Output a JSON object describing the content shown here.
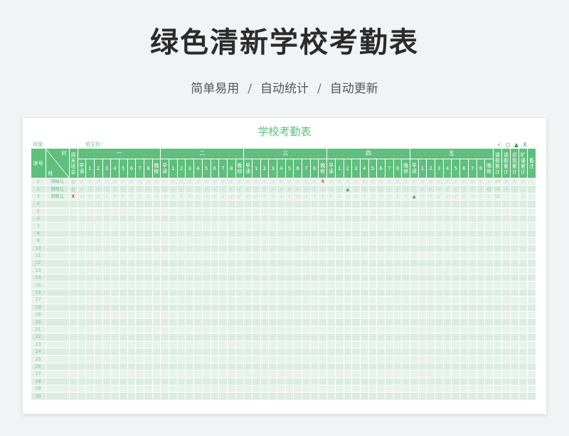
{
  "page": {
    "title": "绿色清新学校考勤表",
    "subtitle": [
      "简单易用",
      "自动统计",
      "自动更新"
    ],
    "separator": "/"
  },
  "sheet": {
    "title": "学校考勤表",
    "class_label": "班级:",
    "teacher_label": "班主任:",
    "legend_symbols": [
      "√",
      "○",
      "▲",
      "X"
    ],
    "headers": {
      "index": "序号",
      "corner_top": "时",
      "corner_bottom": "姓",
      "weekend": "周末班会",
      "morning": "早读",
      "evening": "晚修",
      "periods": [
        "1",
        "2",
        "3",
        "4",
        "5",
        "6",
        "7",
        "8"
      ],
      "days": [
        "一",
        "二",
        "三",
        "四",
        "五"
      ],
      "totals": [
        "请假累计",
        "请假累计",
        "迟到累计",
        "旷课累计"
      ],
      "remark": "备注"
    },
    "rows": [
      {
        "no": "1",
        "name": "刘仙儿",
        "weekend": "○",
        "day_marks": {
          "3-evening": "X"
        },
        "mark_types": {
          "3-evening": "x"
        },
        "totals": [
          "48",
          "3",
          "1",
          "1"
        ],
        "remark": ""
      },
      {
        "no": "2",
        "name": "刘可儿",
        "weekend": "○",
        "day_marks": {
          "4-p2": "▲",
          "5-evening": "○"
        },
        "mark_types": {
          "4-p2": "t",
          "5-evening": "o"
        },
        "totals": [
          "48",
          "2",
          "1",
          ""
        ],
        "remark": ""
      },
      {
        "no": "3",
        "name": "刘欣儿",
        "weekend": "X",
        "day_marks": {
          "5-morning": "▲"
        },
        "mark_types": {
          "5-morning": "t"
        },
        "totals": [
          "50",
          "",
          "",
          "1"
        ],
        "remark": ""
      }
    ],
    "row_count": 30,
    "check_symbol": "√",
    "colors": {
      "header_green": "#5fbf7d",
      "row_light": "#e7f2ea",
      "row_alt": "#dcece1",
      "absent_red": "#e5483c"
    }
  }
}
